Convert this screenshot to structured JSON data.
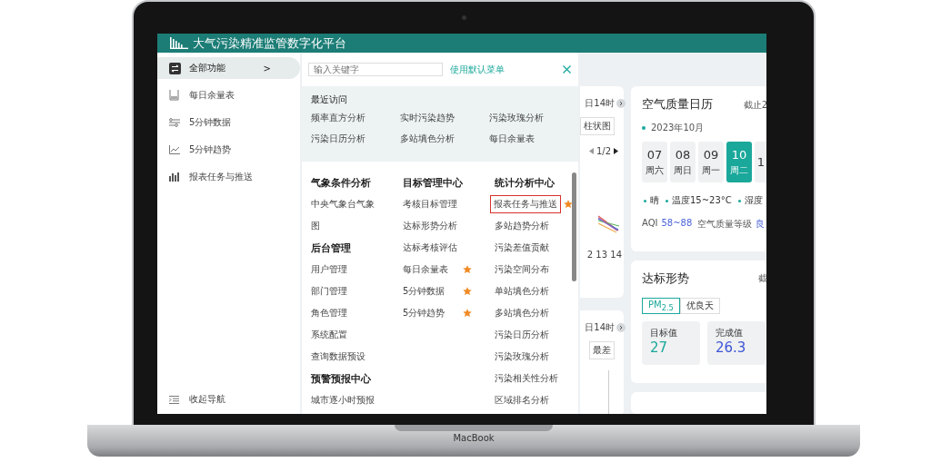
{
  "app": {
    "title": "大气污染精准监管数字化平台"
  },
  "sidebar": {
    "items": [
      {
        "label": "全部功能",
        "selected": true,
        "arrow": ">"
      },
      {
        "label": "每日余量表",
        "selected": false
      },
      {
        "label": "5分钟数据",
        "selected": false
      },
      {
        "label": "5分钟趋势",
        "selected": false
      },
      {
        "label": "报表任务与推送",
        "selected": false
      }
    ],
    "collapse": "收起导航"
  },
  "menu_panel": {
    "search": {
      "placeholder": "输入关键字"
    },
    "default_link": "使用默认菜单",
    "recent": {
      "title": "最近访问",
      "items": [
        "频率直方分析",
        "实时污染趋势",
        "污染玫瑰分析",
        "污染日历分析",
        "多站填色分析",
        "每日余量表"
      ]
    },
    "columns": [
      {
        "items": [
          {
            "kind": "heading",
            "label": "气象条件分析"
          },
          {
            "kind": "link",
            "label": "中央气象台气象图",
            "starred": false,
            "highlighted": false
          },
          {
            "kind": "heading",
            "label": "后台管理"
          },
          {
            "kind": "link",
            "label": "用户管理",
            "starred": false,
            "highlighted": false
          },
          {
            "kind": "link",
            "label": "部门管理",
            "starred": false,
            "highlighted": false
          },
          {
            "kind": "link",
            "label": "角色管理",
            "starred": false,
            "highlighted": false
          },
          {
            "kind": "link",
            "label": "系统配置",
            "starred": false,
            "highlighted": false
          },
          {
            "kind": "link",
            "label": "查询数据预设",
            "starred": false,
            "highlighted": false
          },
          {
            "kind": "heading",
            "label": "预警预报中心"
          },
          {
            "kind": "link",
            "label": "城市逐小时预报",
            "starred": false,
            "highlighted": false
          }
        ]
      },
      {
        "items": [
          {
            "kind": "heading",
            "label": "目标管理中心"
          },
          {
            "kind": "link",
            "label": "考核目标管理",
            "starred": false,
            "highlighted": false
          },
          {
            "kind": "link",
            "label": "达标形势分析",
            "starred": false,
            "highlighted": false
          },
          {
            "kind": "link",
            "label": "达标考核评估",
            "starred": false,
            "highlighted": false
          },
          {
            "kind": "link",
            "label": "每日余量表",
            "starred": true,
            "highlighted": false
          },
          {
            "kind": "link",
            "label": "5分钟数据",
            "starred": true,
            "highlighted": false
          },
          {
            "kind": "link",
            "label": "5分钟趋势",
            "starred": true,
            "highlighted": false
          }
        ]
      },
      {
        "items": [
          {
            "kind": "heading",
            "label": "统计分析中心"
          },
          {
            "kind": "link",
            "label": "报表任务与推送",
            "starred": true,
            "highlighted": true
          },
          {
            "kind": "link",
            "label": "多站趋势分析",
            "starred": false,
            "highlighted": false
          },
          {
            "kind": "link",
            "label": "污染差值贡献",
            "starred": false,
            "highlighted": false
          },
          {
            "kind": "link",
            "label": "污染空间分布",
            "starred": false,
            "highlighted": false
          },
          {
            "kind": "link",
            "label": "单站填色分析",
            "starred": false,
            "highlighted": false
          },
          {
            "kind": "link",
            "label": "多站填色分析",
            "starred": false,
            "highlighted": false
          },
          {
            "kind": "link",
            "label": "污染日历分析",
            "starred": false,
            "highlighted": false
          },
          {
            "kind": "link",
            "label": "污染玫瑰分析",
            "starred": false,
            "highlighted": false
          },
          {
            "kind": "link",
            "label": "污染相关性分析",
            "starred": false,
            "highlighted": false
          },
          {
            "kind": "link",
            "label": "区域排名分析",
            "starred": false,
            "highlighted": false
          }
        ]
      }
    ]
  },
  "dashboard": {
    "partial_cards": [
      {
        "time": "日14时",
        "button": "柱状图",
        "pager": "1/2",
        "axis": "2 13 14"
      },
      {
        "time": "日14时",
        "button": "最差"
      }
    ],
    "calendar": {
      "title": "空气质量日历",
      "note": "截止2",
      "month": "2023年10月",
      "days": [
        {
          "day": "07",
          "week": "周六",
          "selected": false
        },
        {
          "day": "08",
          "week": "周日",
          "selected": false
        },
        {
          "day": "09",
          "week": "周一",
          "selected": false
        },
        {
          "day": "10",
          "week": "周二",
          "selected": true
        },
        {
          "day": "1",
          "selected": false
        }
      ],
      "weather": [
        "晴",
        "温度15~23°C",
        "湿度"
      ],
      "aqi_label": "AQI",
      "aqi_value": "58~88",
      "level_label": "空气质量等级",
      "level_value": "良"
    },
    "target": {
      "title": "达标形势",
      "note": "截",
      "tabs": [
        {
          "label": "PM$_{2.5}$",
          "selected": true
        },
        {
          "label": "优良天",
          "selected": false
        }
      ],
      "stats": [
        {
          "label": "目标值",
          "value": "27",
          "kind": "target"
        },
        {
          "label": "完成值",
          "value": "26.3",
          "kind": "done"
        }
      ]
    }
  },
  "device": {
    "label": "MacBook"
  }
}
